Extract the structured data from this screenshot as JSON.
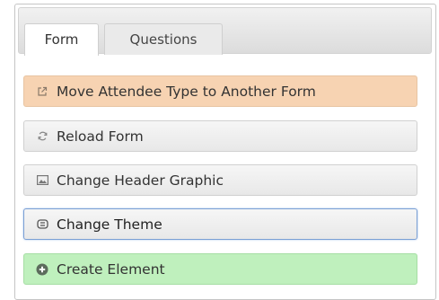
{
  "tabs": [
    {
      "label": "Form",
      "active": true
    },
    {
      "label": "Questions",
      "active": false
    }
  ],
  "actions": [
    {
      "label": "Move Attendee Type to Another Form",
      "icon": "external-link-icon",
      "color": "#f7d3b2"
    },
    {
      "label": "Reload Form",
      "icon": "refresh-icon"
    },
    {
      "label": "Change Header Graphic",
      "icon": "image-icon"
    },
    {
      "label": "Change Theme",
      "icon": "theme-icon",
      "state": "focused"
    },
    {
      "label": "Create Element",
      "icon": "plus-circle-icon",
      "color": "#bff0bd"
    }
  ]
}
